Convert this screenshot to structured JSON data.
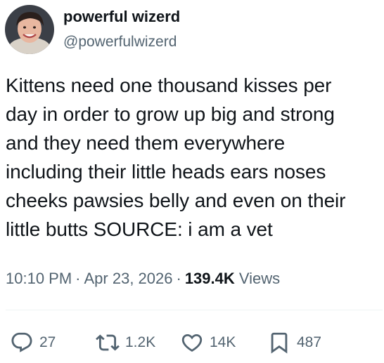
{
  "author": {
    "display_name": "powerful wizerd",
    "handle": "@powerfulwizerd"
  },
  "tweet": {
    "text": "Kittens need one thousand kisses per\nday in order to grow up big and strong\nand they need them everywhere\nincluding their little heads ears noses\ncheeks pawsies belly and even on their\nlittle butts SOURCE: i am a vet",
    "time": "10:10 PM",
    "date": "Apr 23, 2026",
    "separator": "·",
    "views_count": "139.4K",
    "views_label": "Views"
  },
  "actions": {
    "replies": "27",
    "reposts": "1.2K",
    "likes": "14K",
    "bookmarks": "487"
  },
  "colors": {
    "text": "#0f1419",
    "secondary": "#536471",
    "divider": "#eff3f4"
  },
  "icons": {
    "reply": "reply-icon",
    "repost": "repost-icon",
    "like": "heart-icon",
    "bookmark": "bookmark-icon"
  }
}
